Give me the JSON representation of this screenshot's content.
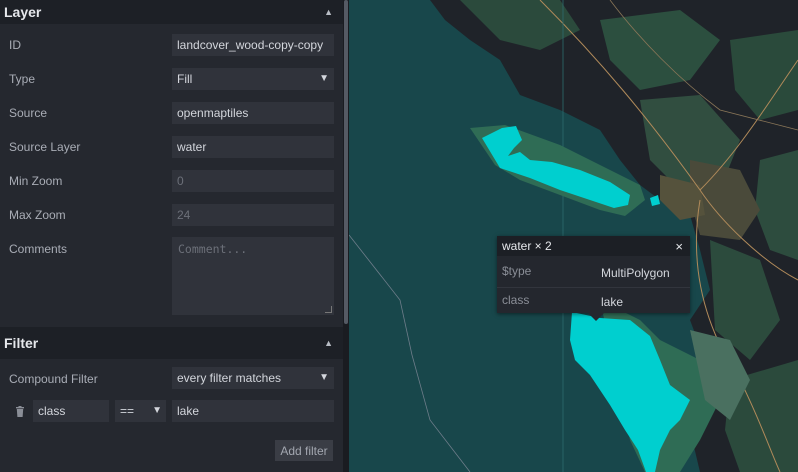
{
  "layer_section": {
    "title": "Layer",
    "fields": {
      "id": {
        "label": "ID",
        "value": "landcover_wood-copy-copy"
      },
      "type": {
        "label": "Type",
        "value": "Fill"
      },
      "source": {
        "label": "Source",
        "value": "openmaptiles"
      },
      "source_layer": {
        "label": "Source Layer",
        "value": "water"
      },
      "min_zoom": {
        "label": "Min Zoom",
        "placeholder": "0"
      },
      "max_zoom": {
        "label": "Max Zoom",
        "placeholder": "24"
      },
      "comments": {
        "label": "Comments",
        "placeholder": "Comment..."
      }
    }
  },
  "filter_section": {
    "title": "Filter",
    "compound": {
      "label": "Compound Filter",
      "value": "every filter matches"
    },
    "rule": {
      "key": "class",
      "operator": "==",
      "value": "lake"
    },
    "add_filter_label": "Add filter"
  },
  "map_popup": {
    "title": "water × 2",
    "close": "×",
    "rows": [
      {
        "key": "$type",
        "value": "MultiPolygon"
      },
      {
        "key": "class",
        "value": "lake"
      }
    ]
  },
  "icons": {
    "collapse": "caret-up-icon",
    "select": "caret-down-icon",
    "delete": "trash-icon"
  },
  "colors": {
    "accent_lake": "#00cfcf",
    "map_water": "#18474b",
    "land_dark": "#1f2329",
    "vegetation": "#2c4f3f"
  }
}
